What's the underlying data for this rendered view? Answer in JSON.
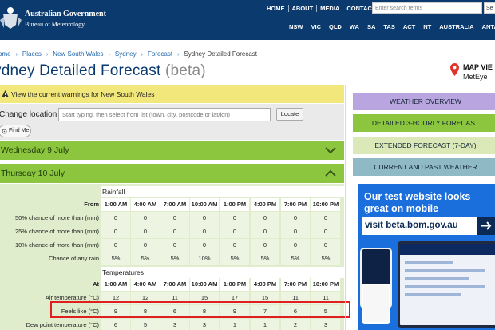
{
  "header": {
    "gov_name": "Australian Government",
    "bureau_name": "Bureau of Meteorology",
    "top_links": [
      "HOME",
      "ABOUT",
      "MEDIA",
      "CONTACTS"
    ],
    "search_placeholder": "Enter search terms",
    "search_button": "Se",
    "states": [
      "NSW",
      "VIC",
      "QLD",
      "WA",
      "SA",
      "TAS",
      "ACT",
      "NT",
      "AUSTRALIA",
      "ANTARCT"
    ]
  },
  "breadcrumb": {
    "items": [
      "ome",
      "Places",
      "New South Wales",
      "Sydney",
      "Forecast"
    ],
    "current": "Sydney Detailed Forecast"
  },
  "page": {
    "title": "ydney Detailed Forecast",
    "beta": "(beta)"
  },
  "map_viewer": {
    "line1": "MAP VIE",
    "line2": "MetEye"
  },
  "warning": {
    "text": "View the current warnings for New South Wales"
  },
  "location": {
    "label": "Change location",
    "placeholder": "Start typing, then select from list (town, city, postcode or lat/lon)",
    "locate_button": "Locate",
    "find_me_button": "Find Me"
  },
  "days": [
    {
      "label": "Wednesday 9 July",
      "expanded": false
    },
    {
      "label": "Thursday 10 July",
      "expanded": true
    }
  ],
  "forecast": {
    "rainfall_title": "Rainfall",
    "temperatures_title": "Temperatures",
    "from_label": "From",
    "at_label": "At",
    "times": [
      "1:00 AM",
      "4:00 AM",
      "7:00 AM",
      "10:00 AM",
      "1:00 PM",
      "4:00 PM",
      "7:00 PM",
      "10:00 PM"
    ],
    "rain_rows": [
      {
        "label": "50% chance of more than (mm)",
        "values": [
          "0",
          "0",
          "0",
          "0",
          "0",
          "0",
          "0",
          "0"
        ]
      },
      {
        "label": "25% chance of more than (mm)",
        "values": [
          "0",
          "0",
          "0",
          "0",
          "0",
          "0",
          "0",
          "0"
        ]
      },
      {
        "label": "10% chance of more than (mm)",
        "values": [
          "0",
          "0",
          "0",
          "0",
          "0",
          "0",
          "0",
          "0"
        ]
      },
      {
        "label": "Chance of any rain",
        "values": [
          "5%",
          "5%",
          "5%",
          "10%",
          "5%",
          "5%",
          "5%",
          "5%"
        ]
      }
    ],
    "temp_rows": [
      {
        "label": "Air temperature (°C)",
        "values": [
          "12",
          "12",
          "11",
          "15",
          "17",
          "15",
          "11",
          "11"
        ]
      },
      {
        "label": "Feels like (°C)",
        "values": [
          "9",
          "8",
          "6",
          "8",
          "9",
          "7",
          "6",
          "5"
        ]
      },
      {
        "label": "Dew point temperature (°C)",
        "values": [
          "6",
          "5",
          "3",
          "3",
          "1",
          "1",
          "2",
          "3"
        ]
      }
    ]
  },
  "right_nav": [
    {
      "label": "WEATHER OVERVIEW",
      "color": "#b9a6e0"
    },
    {
      "label": "DETAILED 3-HOURLY FORECAST",
      "color": "#8cc63f"
    },
    {
      "label": "EXTENDED FORECAST (7-DAY)",
      "color": "#dbe9b8"
    },
    {
      "label": "CURRENT AND PAST WEATHER",
      "color": "#8fb9c4"
    }
  ],
  "ad": {
    "headline": "Our test website looks great on mobile",
    "cta": "visit beta.bom.gov.au"
  },
  "colors": {
    "header_bg": "#0b3a6e",
    "day_bar": "#8cc63f",
    "warning_bg": "#f2e77a",
    "highlight_border": "#e02020"
  }
}
